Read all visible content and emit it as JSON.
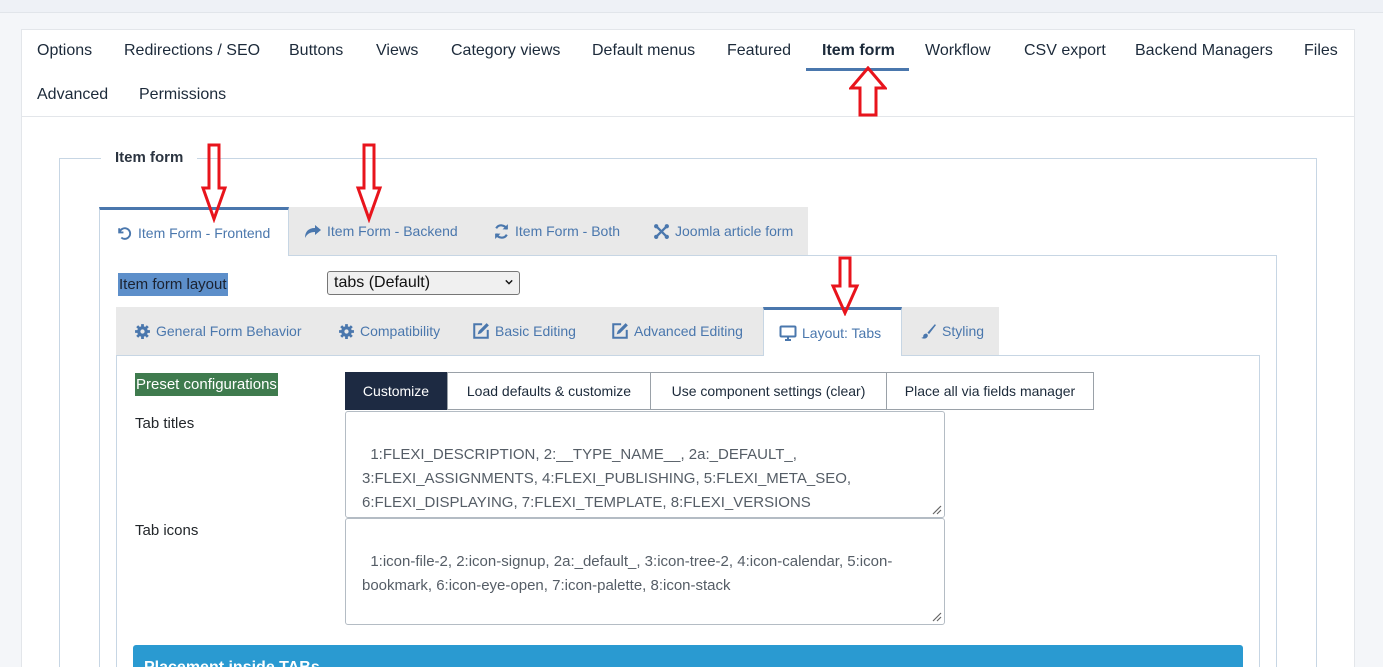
{
  "main_tabs": [
    {
      "label": "Options"
    },
    {
      "label": "Redirections / SEO"
    },
    {
      "label": "Buttons"
    },
    {
      "label": "Views"
    },
    {
      "label": "Category views"
    },
    {
      "label": "Default menus"
    },
    {
      "label": "Featured"
    },
    {
      "label": "Item form",
      "active": true
    },
    {
      "label": "Workflow"
    },
    {
      "label": "CSV export"
    },
    {
      "label": "Backend Managers"
    },
    {
      "label": "Files"
    },
    {
      "label": "Advanced"
    },
    {
      "label": "Permissions"
    }
  ],
  "section": {
    "legend": "Item form"
  },
  "form_tabs": [
    {
      "label": "Item Form - Frontend",
      "icon": "undo-icon",
      "active": true
    },
    {
      "label": "Item Form - Backend",
      "icon": "share-icon"
    },
    {
      "label": "Item Form - Both",
      "icon": "refresh-icon"
    },
    {
      "label": "Joomla article form",
      "icon": "joomla-icon"
    }
  ],
  "layout_field": {
    "label": "Item form layout",
    "value": "tabs (Default)"
  },
  "inner_tabs": [
    {
      "label": "General Form Behavior",
      "icon": "cog-icon"
    },
    {
      "label": "Compatibility",
      "icon": "cog-icon"
    },
    {
      "label": "Basic Editing",
      "icon": "edit-icon"
    },
    {
      "label": "Advanced Editing",
      "icon": "edit-icon"
    },
    {
      "label": "Layout: Tabs",
      "icon": "monitor-icon",
      "active": true
    },
    {
      "label": "Styling",
      "icon": "brush-icon"
    }
  ],
  "preset": {
    "label": "Preset configurations",
    "buttons": [
      "Customize",
      "Load defaults & customize",
      "Use component settings (clear)",
      "Place all via fields manager"
    ]
  },
  "tab_titles": {
    "label": "Tab titles",
    "value": "1:FLEXI_DESCRIPTION, 2:__TYPE_NAME__, 2a:_DEFAULT_,\n3:FLEXI_ASSIGNMENTS, 4:FLEXI_PUBLISHING, 5:FLEXI_META_SEO,\n6:FLEXI_DISPLAYING, 7:FLEXI_TEMPLATE, 8:FLEXI_VERSIONS"
  },
  "tab_icons": {
    "label": "Tab icons",
    "value": "1:icon-file-2, 2:icon-signup, 2a:_default_, 3:icon-tree-2, 4:icon-calendar, 5:icon-\nbookmark, 6:icon-eye-open, 7:icon-palette, 8:icon-stack"
  },
  "placement_bar": {
    "label": "Placement inside TABs"
  },
  "colors": {
    "accent": "#4a77ad",
    "preset_green": "#3f7b4e",
    "highlight_blue": "#5d8fca",
    "bar_blue": "#2a9ad1",
    "arrow_red": "#e8141c",
    "dark_button": "#1d2a42"
  }
}
